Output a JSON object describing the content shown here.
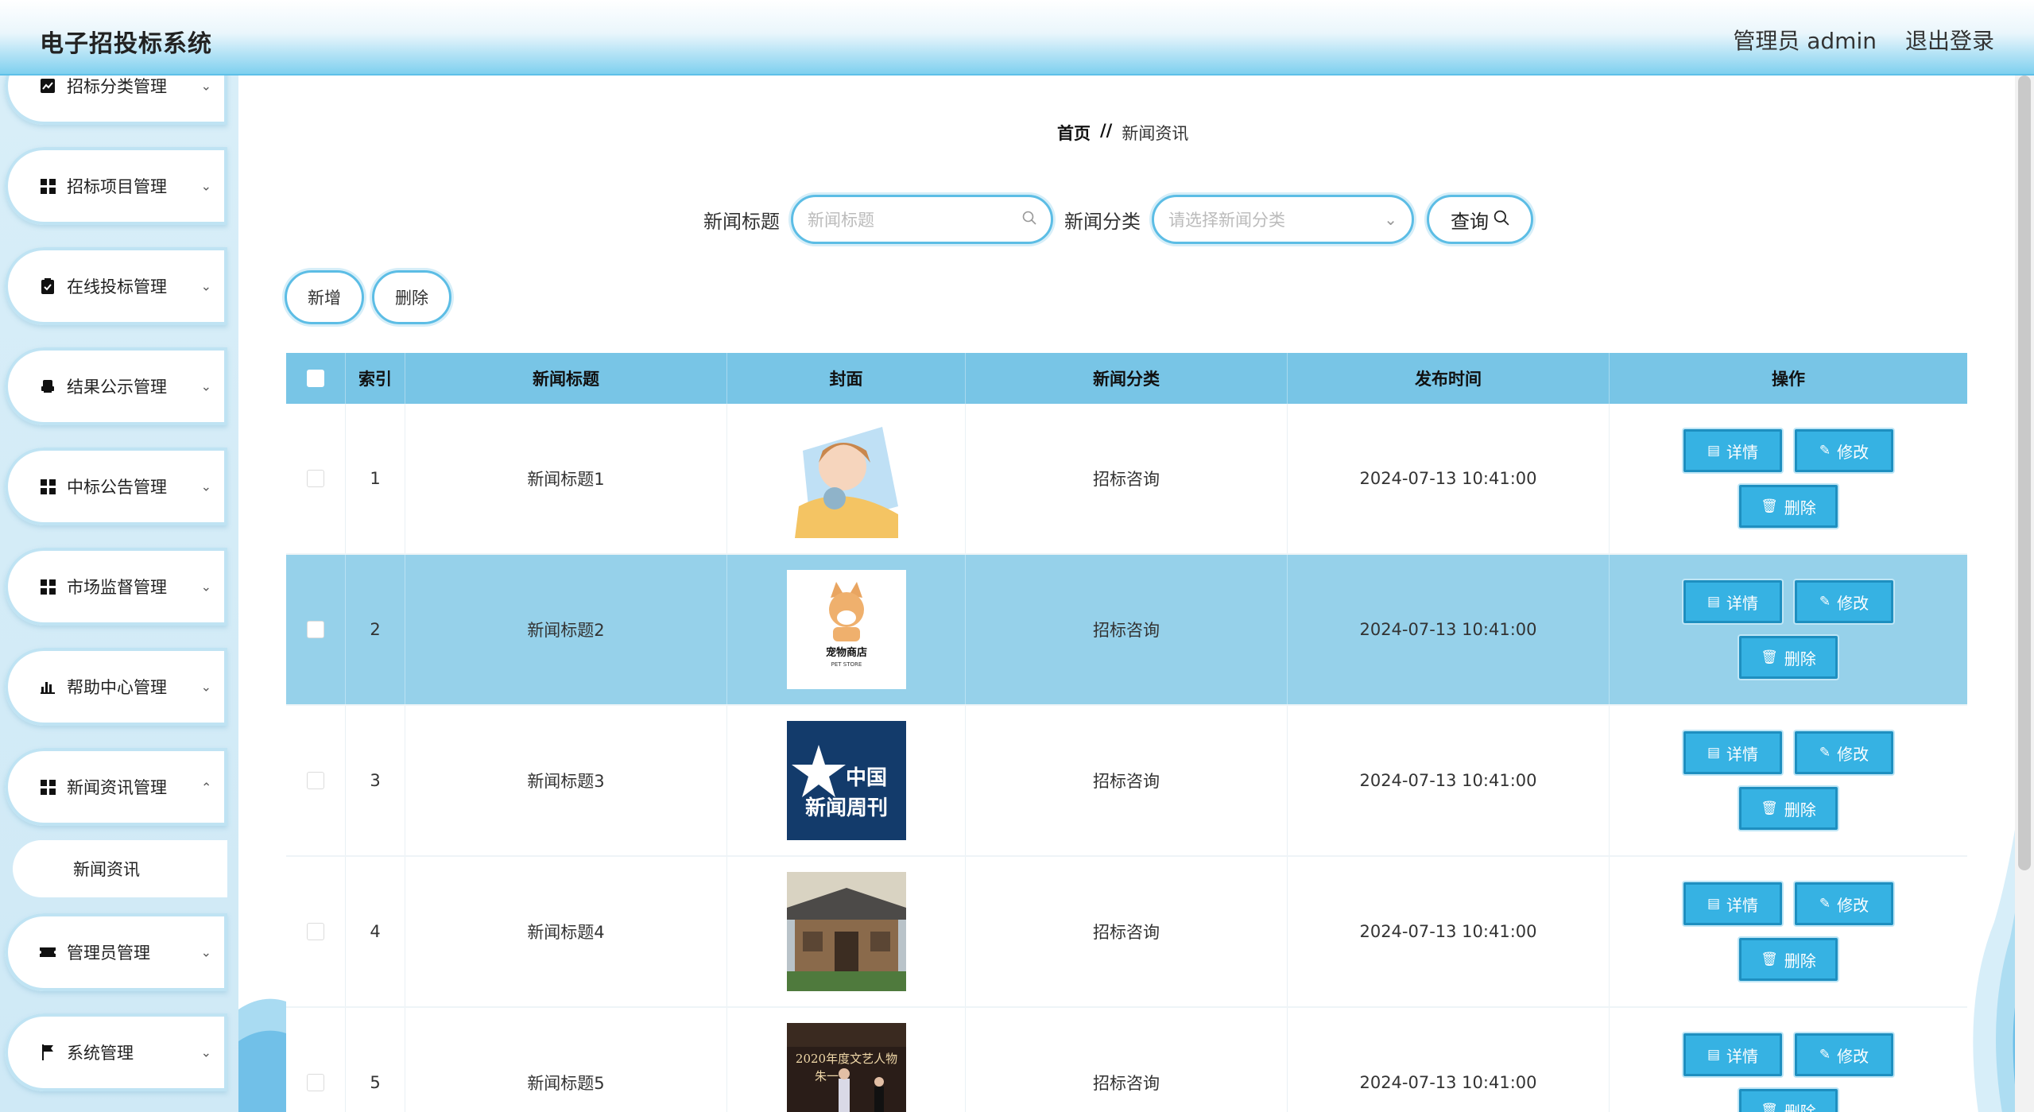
{
  "header": {
    "app_title": "电子招投标系统",
    "user_label": "管理员 admin",
    "logout_label": "退出登录"
  },
  "sidebar": {
    "items": [
      {
        "label": "招标分类管理",
        "icon": "chart-line-icon"
      },
      {
        "label": "招标项目管理",
        "icon": "grid-icon"
      },
      {
        "label": "在线投标管理",
        "icon": "clipboard-check-icon"
      },
      {
        "label": "结果公示管理",
        "icon": "printer-icon"
      },
      {
        "label": "中标公告管理",
        "icon": "grid-icon"
      },
      {
        "label": "市场监督管理",
        "icon": "grid-icon"
      },
      {
        "label": "帮助中心管理",
        "icon": "bar-chart-icon"
      },
      {
        "label": "新闻资讯管理",
        "icon": "grid-icon"
      },
      {
        "label": "管理员管理",
        "icon": "ticket-icon"
      },
      {
        "label": "系统管理",
        "icon": "flag-icon"
      }
    ],
    "submenu": {
      "label": "新闻资讯"
    }
  },
  "breadcrumb": {
    "home": "首页",
    "separator": "//",
    "current": "新闻资讯"
  },
  "search": {
    "title_label": "新闻标题",
    "title_placeholder": "新闻标题",
    "category_label": "新闻分类",
    "category_placeholder": "请选择新闻分类",
    "query_label": "查询"
  },
  "actions": {
    "add_label": "新增",
    "delete_label": "删除"
  },
  "table": {
    "columns": [
      "索引",
      "新闻标题",
      "封面",
      "新闻分类",
      "发布时间",
      "操作"
    ],
    "rows": [
      {
        "index": "1",
        "title": "新闻标题1",
        "category": "招标咨询",
        "time": "2024-07-13 10:41:00",
        "cover": "sleeping-girl"
      },
      {
        "index": "2",
        "title": "新闻标题2",
        "category": "招标咨询",
        "time": "2024-07-13 10:41:00",
        "cover": "pet-store",
        "cover_text": "宠物商店",
        "cover_sub": "PET STORE"
      },
      {
        "index": "3",
        "title": "新闻标题3",
        "category": "招标咨询",
        "time": "2024-07-13 10:41:00",
        "cover": "china-news-weekly",
        "cover_text": "中国",
        "cover_sub": "新闻周刊"
      },
      {
        "index": "4",
        "title": "新闻标题4",
        "category": "招标咨询",
        "time": "2024-07-13 10:41:00",
        "cover": "old-house"
      },
      {
        "index": "5",
        "title": "新闻标题5",
        "category": "招标咨询",
        "time": "2024-07-13 10:41:00",
        "cover": "award-stage",
        "cover_text": "2020年度文艺人物",
        "cover_sub": "朱一"
      }
    ],
    "op_detail": "详情",
    "op_edit": "修改",
    "op_delete": "删除"
  },
  "colors": {
    "accent": "#36b2e3",
    "header_gradient_end": "#7fd0ef",
    "table_header": "#78c5e6",
    "row_highlight": "#96d1ea"
  }
}
